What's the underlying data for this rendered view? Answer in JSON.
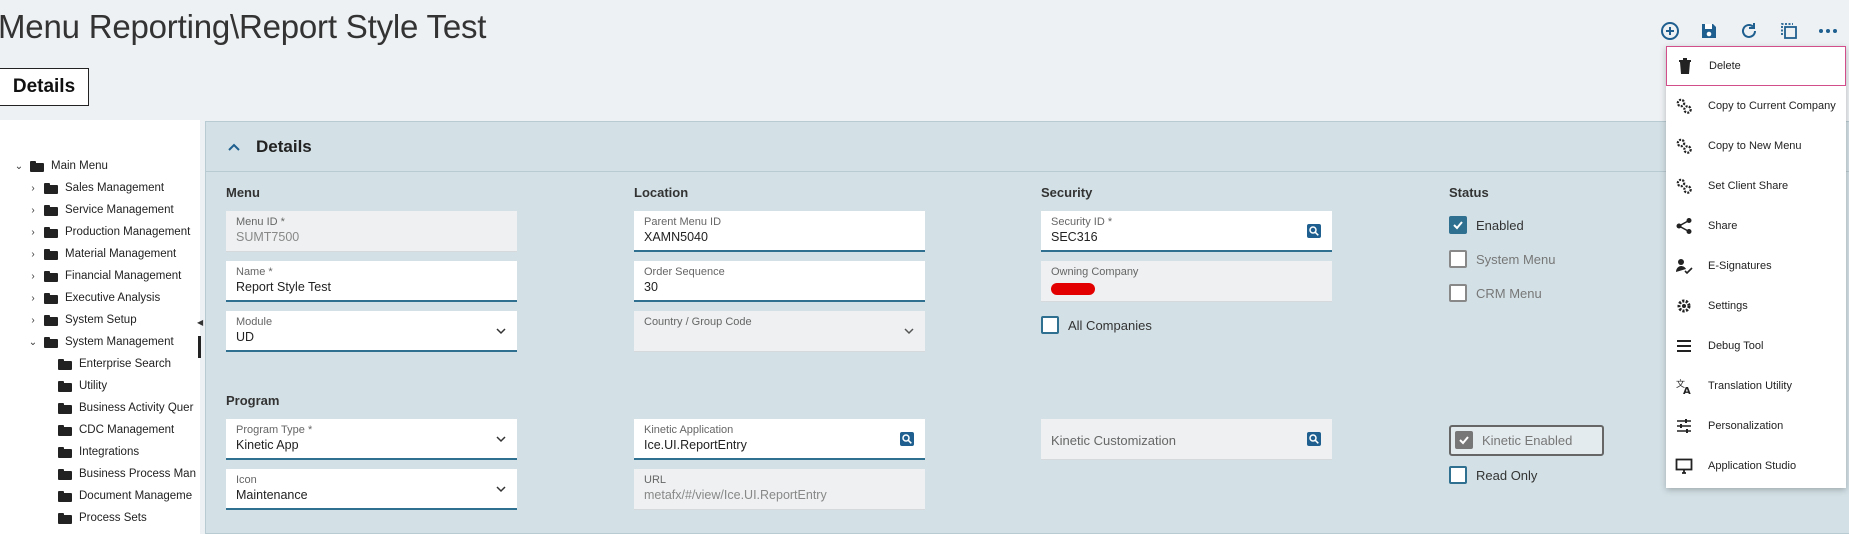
{
  "title": "Menu Reporting\\Report Style Test",
  "tab": "Details",
  "toolbar": [
    "add-icon",
    "save-icon",
    "refresh-icon",
    "copy-icon",
    "more-icon"
  ],
  "tree": {
    "root": "Main Menu",
    "items": [
      {
        "label": "Sales Management",
        "expanded": false,
        "level": 1
      },
      {
        "label": "Service Management",
        "expanded": false,
        "level": 1
      },
      {
        "label": "Production Management",
        "expanded": false,
        "level": 1
      },
      {
        "label": "Material Management",
        "expanded": false,
        "level": 1
      },
      {
        "label": "Financial Management",
        "expanded": false,
        "level": 1
      },
      {
        "label": "Executive Analysis",
        "expanded": false,
        "level": 1
      },
      {
        "label": "System Setup",
        "expanded": false,
        "level": 1
      },
      {
        "label": "System Management",
        "expanded": true,
        "level": 1
      },
      {
        "label": "Enterprise Search",
        "level": 2
      },
      {
        "label": "Utility",
        "level": 2
      },
      {
        "label": "Business Activity Quer",
        "level": 2
      },
      {
        "label": "CDC Management",
        "level": 2
      },
      {
        "label": "Integrations",
        "level": 2
      },
      {
        "label": "Business Process Man",
        "level": 2
      },
      {
        "label": "Document Manageme",
        "level": 2
      },
      {
        "label": "Process Sets",
        "level": 2
      }
    ]
  },
  "panel": {
    "title": "Details",
    "sections": {
      "menu": "Menu",
      "location": "Location",
      "security": "Security",
      "status": "Status",
      "program": "Program"
    },
    "fields": {
      "menu_id": {
        "label": "Menu ID *",
        "value": "SUMT7500"
      },
      "name": {
        "label": "Name *",
        "value": "Report Style Test"
      },
      "module": {
        "label": "Module",
        "value": "UD"
      },
      "parent_menu_id": {
        "label": "Parent Menu ID",
        "value": "XAMN5040"
      },
      "order_sequence": {
        "label": "Order Sequence",
        "value": "30"
      },
      "country_group": {
        "label": "Country / Group Code",
        "value": ""
      },
      "security_id": {
        "label": "Security ID *",
        "value": "SEC316"
      },
      "owning_company": {
        "label": "Owning Company",
        "value": ""
      },
      "program_type": {
        "label": "Program Type *",
        "value": "Kinetic App"
      },
      "icon": {
        "label": "Icon",
        "value": "Maintenance"
      },
      "kinetic_application": {
        "label": "Kinetic Application",
        "value": "Ice.UI.ReportEntry"
      },
      "url": {
        "label": "URL",
        "value": "metafx/#/view/Ice.UI.ReportEntry"
      },
      "kinetic_customization": {
        "label": "Kinetic Customization",
        "value": ""
      }
    },
    "checkboxes": {
      "all_companies": {
        "label": "All Companies",
        "checked": false
      },
      "enabled": {
        "label": "Enabled",
        "checked": true
      },
      "system_menu": {
        "label": "System Menu",
        "checked": false
      },
      "crm_menu": {
        "label": "CRM Menu",
        "checked": false
      },
      "kinetic_enabled": {
        "label": "Kinetic Enabled",
        "checked": true
      },
      "read_only": {
        "label": "Read Only",
        "checked": false
      }
    }
  },
  "overflow_menu": [
    {
      "label": "Delete",
      "icon": "trash-icon"
    },
    {
      "label": "Copy to Current Company",
      "icon": "gears-icon"
    },
    {
      "label": "Copy to New Menu",
      "icon": "gears-icon"
    },
    {
      "label": "Set Client Share",
      "icon": "gears-icon"
    },
    {
      "label": "Share",
      "icon": "share-icon"
    },
    {
      "label": "E-Signatures",
      "icon": "signature-icon"
    },
    {
      "label": "Settings",
      "icon": "gear-icon"
    },
    {
      "label": "Debug Tool",
      "icon": "list-icon"
    },
    {
      "label": "Translation Utility",
      "icon": "translate-icon"
    },
    {
      "label": "Personalization",
      "icon": "sliders-icon"
    },
    {
      "label": "Application Studio",
      "icon": "monitor-icon"
    }
  ],
  "colors": {
    "accent": "#2f6f8f",
    "panel": "#d3e1e6",
    "background": "#eef1f4",
    "redaction": "#e30000",
    "selected_border": "#d14e8a"
  }
}
